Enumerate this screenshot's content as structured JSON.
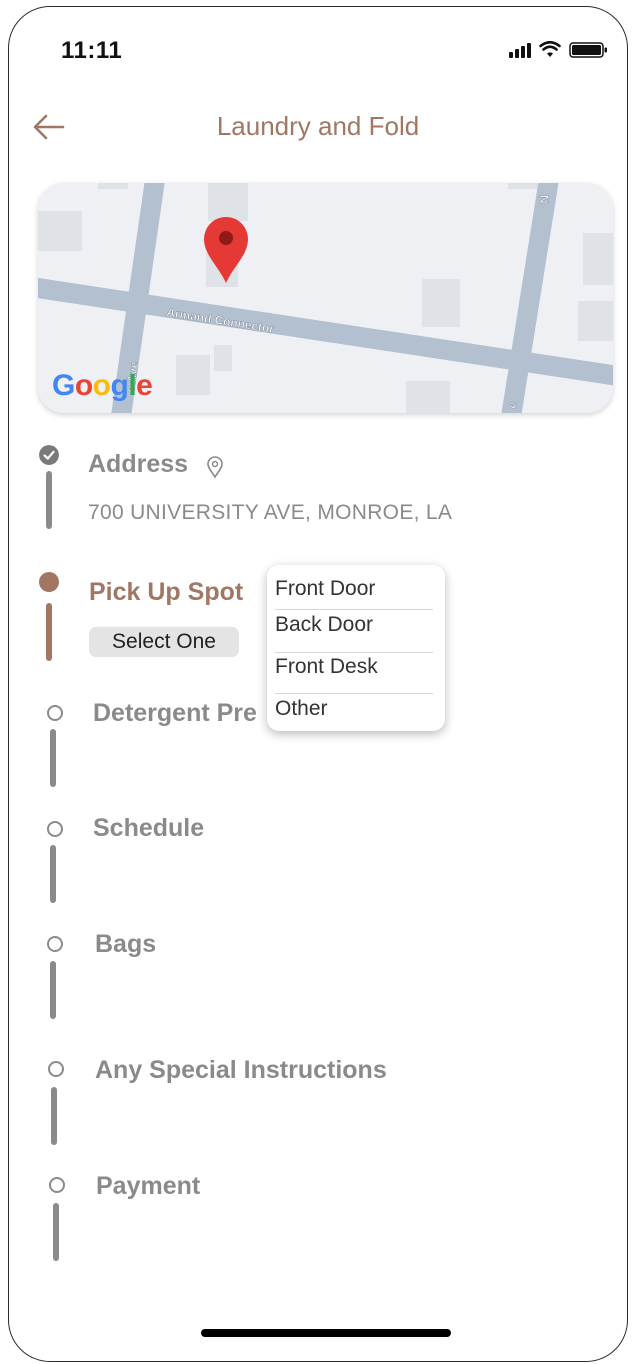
{
  "status": {
    "time": "11:11"
  },
  "header": {
    "title": "Laundry and Fold",
    "back_icon": "arrow-left-icon"
  },
  "map": {
    "street_name": "Armand Connector",
    "street_left": "e Ave",
    "street_bottom": "e",
    "street_right": "N",
    "attribution": [
      "G",
      "o",
      "o",
      "g",
      "l",
      "e"
    ],
    "marker_icon": "map-pin-icon"
  },
  "steps": {
    "address": {
      "label": "Address",
      "value": "700 UNIVERSITY AVE, MONROE, LA",
      "state": "completed"
    },
    "pickup": {
      "label": "Pick Up Spot",
      "select_label": "Select One",
      "state": "active"
    },
    "detergent": {
      "label": "Detergent Pre",
      "state": "pending"
    },
    "schedule": {
      "label": "Schedule",
      "state": "pending"
    },
    "bags": {
      "label": "Bags",
      "state": "pending"
    },
    "instructions": {
      "label": "Any Special Instructions",
      "state": "pending"
    },
    "payment": {
      "label": "Payment",
      "state": "pending"
    }
  },
  "dropdown": {
    "options": [
      "Front Door",
      "Back Door",
      "Front Desk",
      "Other"
    ]
  },
  "colors": {
    "accent": "#a17764",
    "gray": "#8a8a8a",
    "marker": "#e53935"
  }
}
